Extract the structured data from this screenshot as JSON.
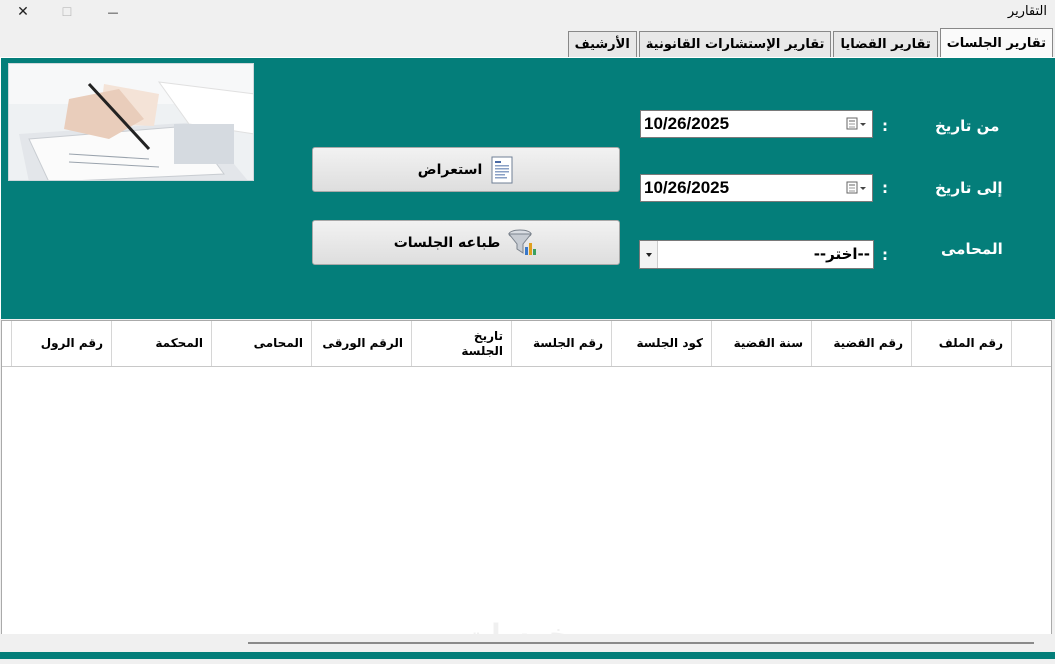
{
  "window": {
    "title": "التقارير",
    "close_glyph": "✕",
    "maximize_glyph": "☐",
    "minimize_glyph": "—"
  },
  "tabs": [
    {
      "label": "تقارير الجلسات",
      "active": true
    },
    {
      "label": "تقارير القضايا",
      "active": false
    },
    {
      "label": "تقارير الإستشارات القانونية",
      "active": false
    },
    {
      "label": "الأرشيف",
      "active": false
    }
  ],
  "filters": {
    "from_label": "من تاريخ",
    "from_value": "10/26/2025",
    "to_label": "إلى تاريخ",
    "to_value": "10/26/2025",
    "lawyer_label": "المحامى",
    "lawyer_value": "--اختر--",
    "colon": ":"
  },
  "buttons": {
    "view_label": "استعراض",
    "print_label": "طباعه الجلسات"
  },
  "table": {
    "columns": [
      "رقم الملف",
      "رقم القضية",
      "سنة القضية",
      "كود الجلسة",
      "رقم الجلسة",
      "تاريخ الجلسة",
      "الرقم الورقى",
      "المحامى",
      "المحكمة",
      "رقم الرول"
    ],
    "rows": []
  },
  "watermark": "خمسات",
  "colors": {
    "panel": "#047e7a",
    "window": "#f0f0f0"
  }
}
